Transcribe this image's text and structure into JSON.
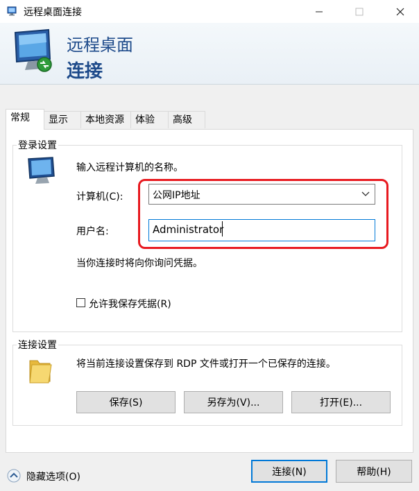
{
  "window": {
    "title": "远程桌面连接"
  },
  "banner": {
    "line1": "远程桌面",
    "line2": "连接"
  },
  "tabs": [
    {
      "label": "常规"
    },
    {
      "label": "显示"
    },
    {
      "label": "本地资源"
    },
    {
      "label": "体验"
    },
    {
      "label": "高级"
    }
  ],
  "login": {
    "group_title": "登录设置",
    "prompt": "输入远程计算机的名称。",
    "computer_label": "计算机(C):",
    "computer_value": "公网IP地址",
    "user_label": "用户名:",
    "user_value": "Administrator",
    "credential_note": "当你连接时将向你询问凭据。",
    "save_credentials_label": "允许我保存凭据(R)",
    "save_credentials_checked": false
  },
  "connection": {
    "group_title": "连接设置",
    "description": "将当前连接设置保存到 RDP 文件或打开一个已保存的连接。",
    "save_button": "保存(S)",
    "save_as_button": "另存为(V)...",
    "open_button": "打开(E)..."
  },
  "footer": {
    "hide_options": "隐藏选项(O)",
    "connect_button": "连接(N)",
    "help_button": "帮助(H)"
  },
  "colors": {
    "accent": "#0078d7",
    "highlight": "#e8191f",
    "banner_text": "#1d4a8a"
  }
}
